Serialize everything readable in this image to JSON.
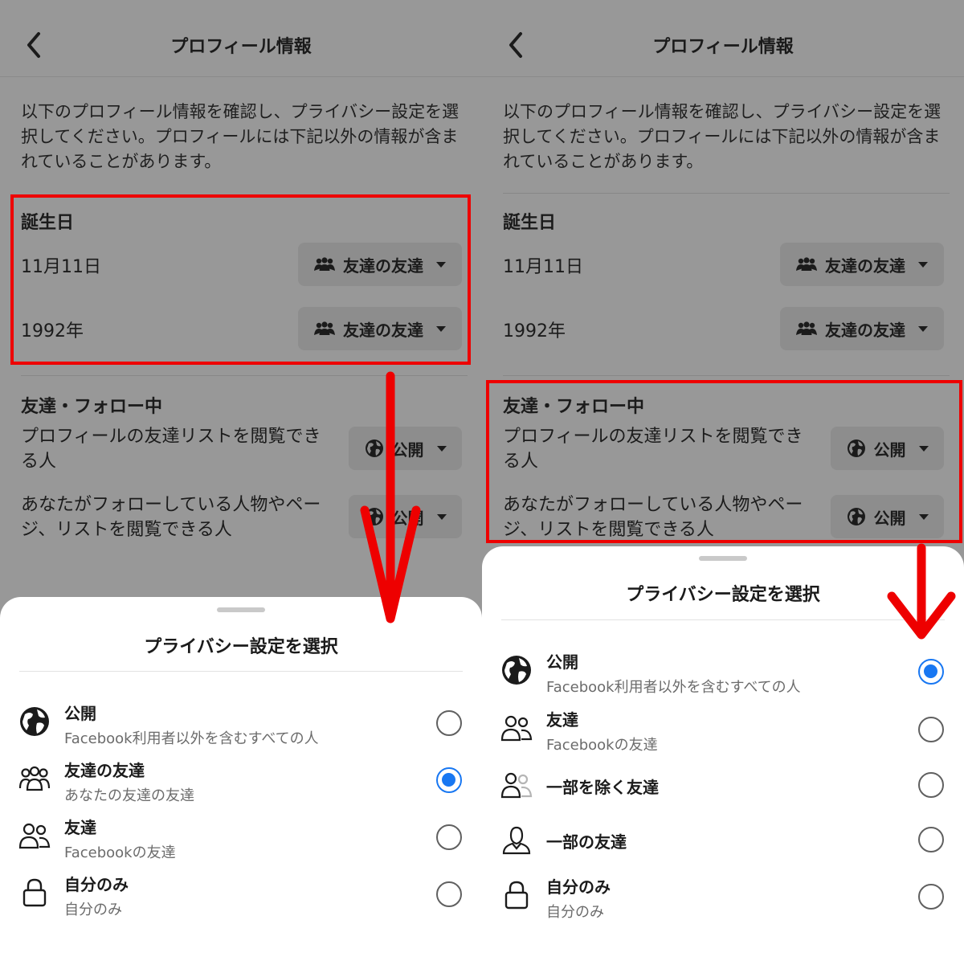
{
  "header": {
    "title": "プロフィール情報"
  },
  "intro": "以下のプロフィール情報を確認し、プライバシー設定を選択してください。プロフィールには下記以外の情報が含まれていることがあります。",
  "birthday": {
    "title": "誕生日",
    "date": "11月11日",
    "year": "1992年",
    "date_audience": "友達の友達",
    "year_audience": "友達の友達"
  },
  "friends": {
    "title": "友達・フォロー中",
    "friend_list_label": "プロフィールの友達リストを閲覧できる人",
    "friend_list_audience": "公開",
    "following_label": "あなたがフォローしている人物やページ、リストを閲覧できる人",
    "following_audience": "公開"
  },
  "sheet_left": {
    "title": "プライバシー設定を選択",
    "options": [
      {
        "title": "公開",
        "subtitle": "Facebook利用者以外を含むすべての人",
        "icon": "globe-icon",
        "selected": false
      },
      {
        "title": "友達の友達",
        "subtitle": "あなたの友達の友達",
        "icon": "friends-of-friends-icon",
        "selected": true
      },
      {
        "title": "友達",
        "subtitle": "Facebookの友達",
        "icon": "friends-icon",
        "selected": false
      },
      {
        "title": "自分のみ",
        "subtitle": "自分のみ",
        "icon": "lock-icon",
        "selected": false
      }
    ]
  },
  "sheet_right": {
    "title": "プライバシー設定を選択",
    "options": [
      {
        "title": "公開",
        "subtitle": "Facebook利用者以外を含むすべての人",
        "icon": "globe-icon",
        "selected": true
      },
      {
        "title": "友達",
        "subtitle": "Facebookの友達",
        "icon": "friends-icon",
        "selected": false
      },
      {
        "title": "一部を除く友達",
        "subtitle": "",
        "icon": "friends-except-icon",
        "selected": false
      },
      {
        "title": "一部の友達",
        "subtitle": "",
        "icon": "specific-friends-icon",
        "selected": false
      },
      {
        "title": "自分のみ",
        "subtitle": "自分のみ",
        "icon": "lock-icon",
        "selected": false
      }
    ]
  },
  "colors": {
    "accent": "#1877f2",
    "highlight": "#ee0000",
    "overlay": "#989898"
  }
}
